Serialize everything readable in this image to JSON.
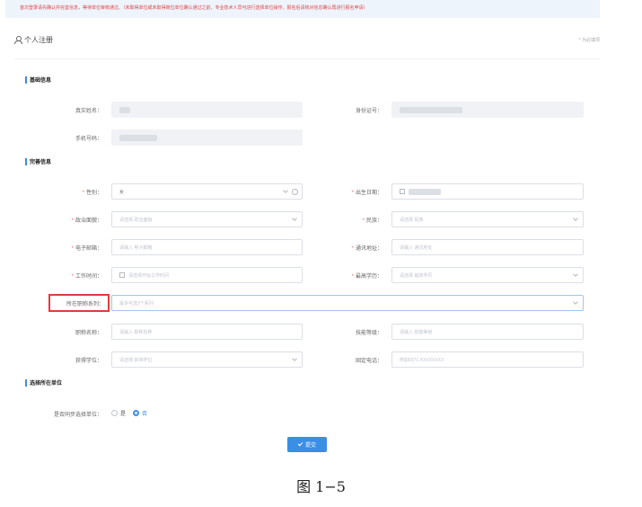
{
  "notice": "首次登录请先确认并完善信息，等待单位审核通过。（未取得单位或未取得岗位单位确认通过之前，专业技术人员可进行选择单位操作。报名后请核对信息确认再进行报名申请）",
  "header": {
    "title": "个人注册",
    "required_note": "* 为必填项"
  },
  "sections": {
    "basic": "基础信息",
    "complete": "完善信息",
    "unit": "选择所在单位"
  },
  "fields": {
    "real_name": {
      "label": "真实姓名：",
      "required": false
    },
    "id_number": {
      "label": "身份证号：",
      "required": false
    },
    "phone": {
      "label": "手机号码：",
      "required": false
    },
    "gender": {
      "label": "性别：",
      "required": true,
      "value": "女"
    },
    "birth_date": {
      "label": "出生日期：",
      "required": true
    },
    "political": {
      "label": "政治面貌：",
      "required": true,
      "placeholder": "请选择 政治面貌"
    },
    "ethnicity": {
      "label": "民族：",
      "required": true,
      "placeholder": "请选择 民族"
    },
    "email": {
      "label": "电子邮箱：",
      "required": true,
      "placeholder": "请输入 电子邮箱"
    },
    "address": {
      "label": "通讯地址：",
      "required": true,
      "placeholder": "请输入 通讯地址"
    },
    "work_time": {
      "label": "工作时间：",
      "required": true,
      "placeholder": "请选择开始工作时间"
    },
    "education": {
      "label": "最高学历：",
      "required": true,
      "placeholder": "请选择 最高学历"
    },
    "title_series": {
      "label": "所在职称系列：",
      "required": false,
      "placeholder": "最多可选3个系列"
    },
    "title_name": {
      "label": "职称名称：",
      "required": false,
      "placeholder": "请输入 职称名称"
    },
    "skill_level": {
      "label": "技能等级：",
      "required": false,
      "placeholder": "请输入 技能等级"
    },
    "degree": {
      "label": "获得学位：",
      "required": false,
      "placeholder": "请选择 获得学位"
    },
    "landline": {
      "label": "固定电话：",
      "required": false,
      "placeholder": "例如0371-XXXXXXXX"
    }
  },
  "sync_unit": {
    "label": "是否同步选择单位：",
    "options": [
      "是",
      "否"
    ],
    "selected": "否"
  },
  "submit_label": "提交",
  "caption": "图 1−5",
  "colors": {
    "accent": "#3a8ee6",
    "highlight": "#e23b3b",
    "required": "#f56c6c"
  }
}
